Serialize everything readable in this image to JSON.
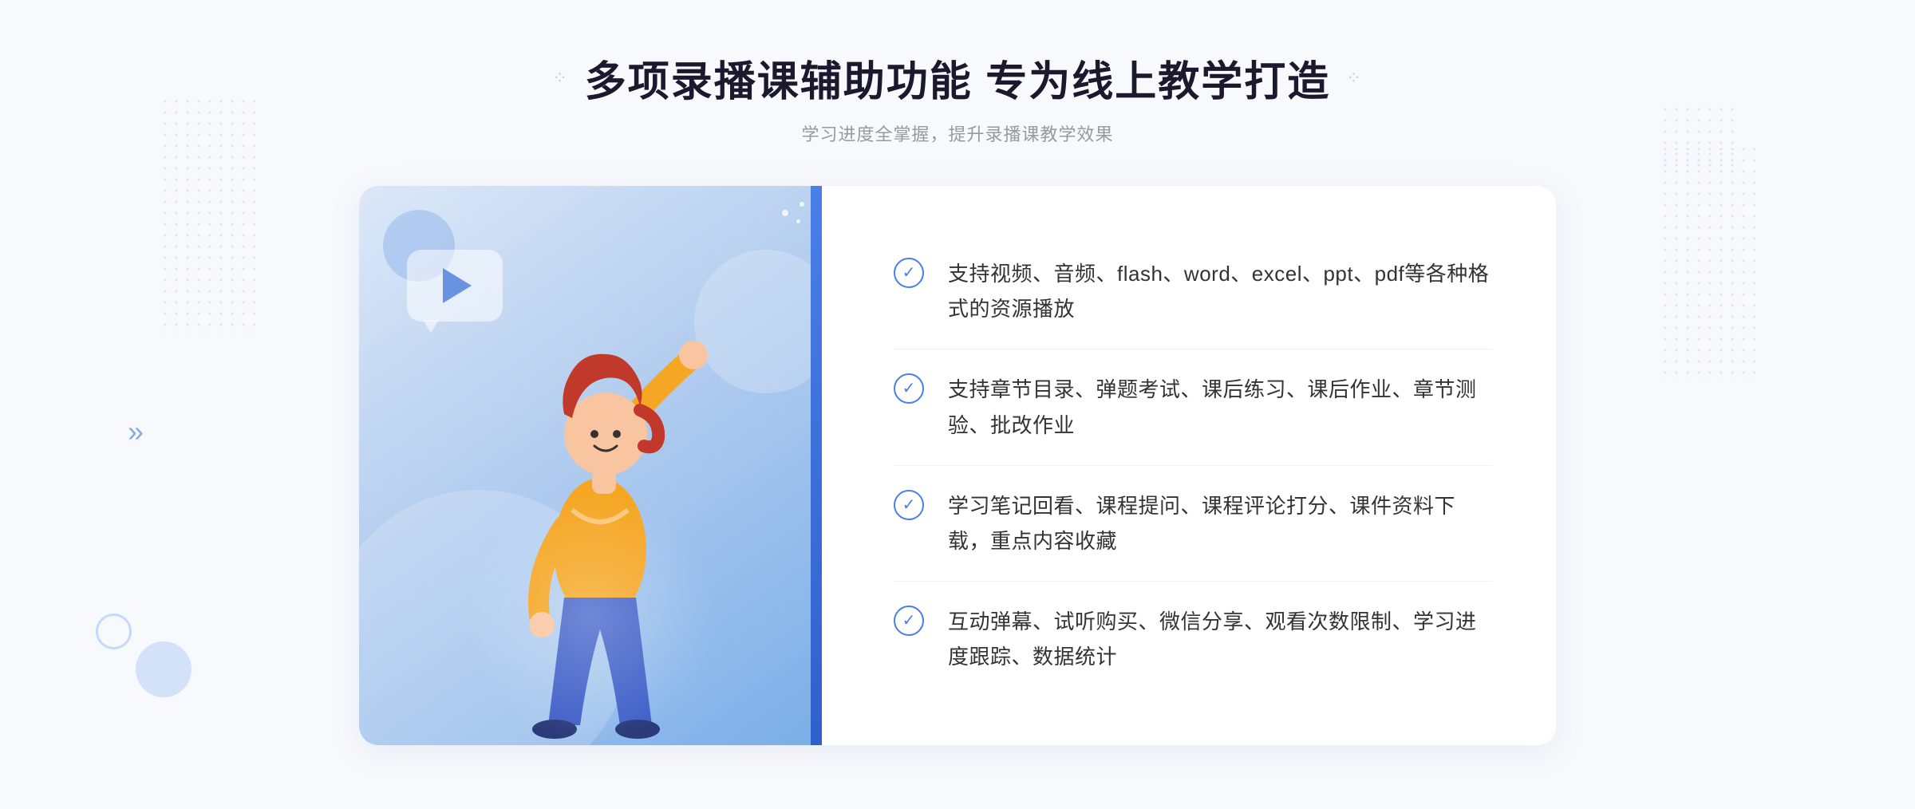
{
  "header": {
    "title": "多项录播课辅助功能 专为线上教学打造",
    "subtitle": "学习进度全掌握，提升录播课教学效果",
    "dots_left": "⁘",
    "dots_right": "⁘"
  },
  "features": [
    {
      "id": 1,
      "text": "支持视频、音频、flash、word、excel、ppt、pdf等各种格式的资源播放"
    },
    {
      "id": 2,
      "text": "支持章节目录、弹题考试、课后练习、课后作业、章节测验、批改作业"
    },
    {
      "id": 3,
      "text": "学习笔记回看、课程提问、课程评论打分、课件资料下载，重点内容收藏"
    },
    {
      "id": 4,
      "text": "互动弹幕、试听购买、微信分享、观看次数限制、学习进度跟踪、数据统计"
    }
  ],
  "chevron": "»",
  "decorations": {
    "play_button_label": "play"
  }
}
